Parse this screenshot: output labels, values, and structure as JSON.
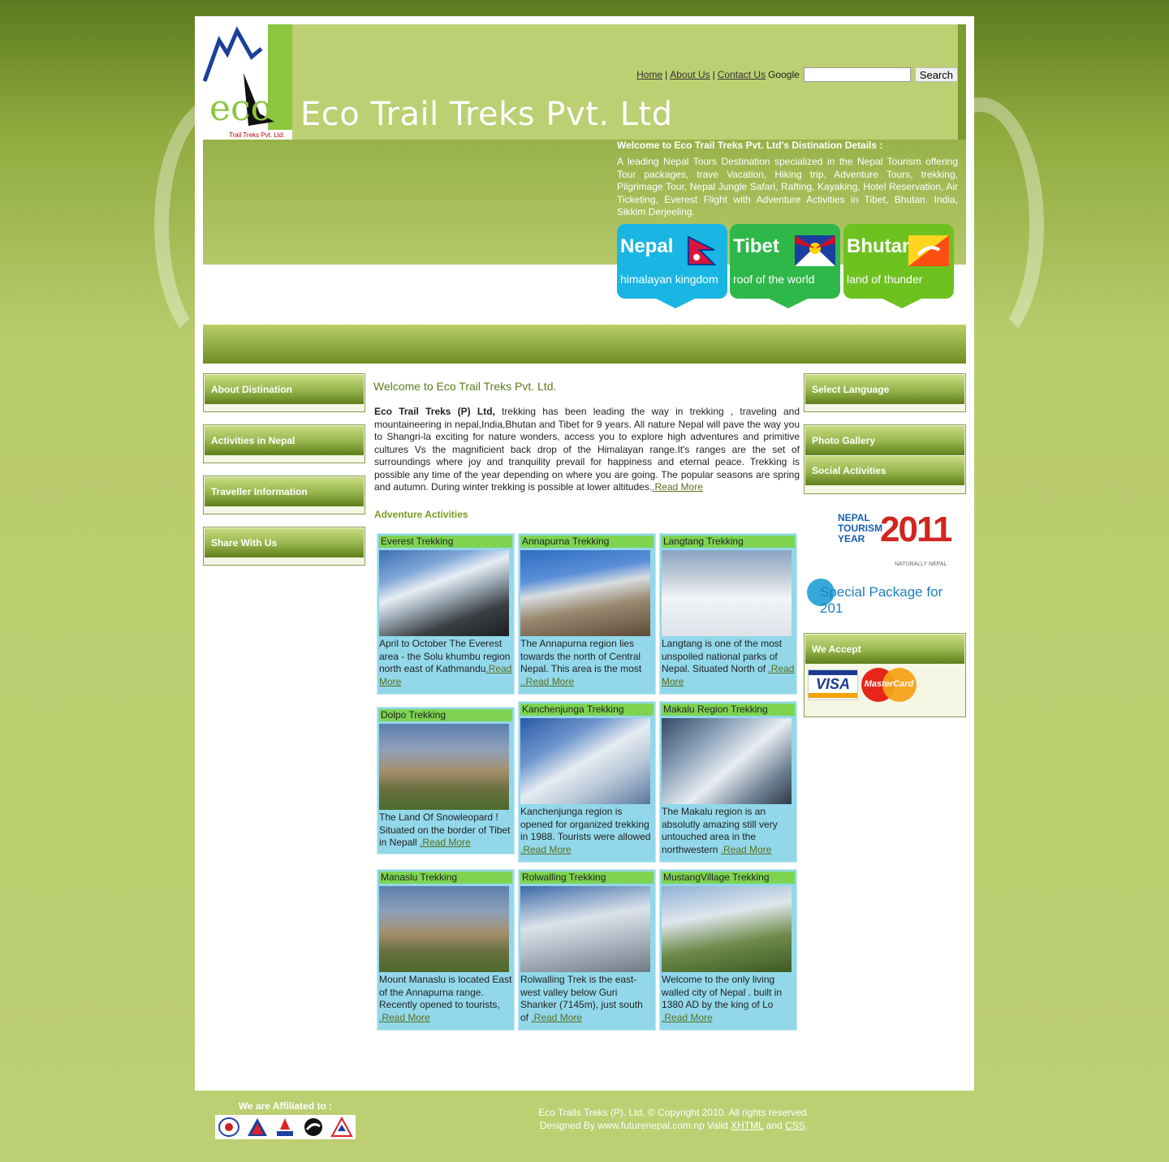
{
  "brand": {
    "name": "Eco Trail Treks Pvt. Ltd",
    "logo_text": "eco",
    "logo_sub": "Trail Treks Pvt. Ltd."
  },
  "topnav": {
    "home": "Home",
    "about": "About Us",
    "contact": "Contact Us",
    "sep": "|",
    "google": "Google",
    "search_value": "",
    "search_button": "Search"
  },
  "welcome": {
    "title": "Welcome to Eco Trail Treks Pvt. Ltd's Distination Details :",
    "text": "A leading Nepal Tours Destination specialized in the Nepal Tourism offering Tour packages, trave Vacation, Hiking trip, Adventure Tours, trekking, Pilgrimage Tour, Nepal Jungle Safari, Rafting, Kayaking, Hotel Reservation, Air Ticketing, Everest Flight with Adventure Activities in Tibet, Bhutan. India, Sikkim Derjeeling."
  },
  "destinations": [
    {
      "name": "Nepal",
      "tagline": "himalayan kingdom",
      "color": "#19b6e3"
    },
    {
      "name": "Tibet",
      "tagline": "roof of the world",
      "color": "#2fb84a"
    },
    {
      "name": "Bhutan",
      "tagline": "land of thunder",
      "color": "#6ec21f"
    }
  ],
  "left_boxes": [
    "About Distination",
    "Activities in Nepal",
    "Traveller Information",
    "Share With Us"
  ],
  "right_boxes": {
    "language": "Select Language",
    "gallery": "Photo Gallery",
    "social": "Social Activities",
    "accept": "We Accept"
  },
  "promo": {
    "line1": "NEPAL",
    "line2": "TOURISM",
    "line3": "YEAR",
    "year": "2011",
    "tag": "NATURALLY NEPAL",
    "special": "Special Package for 201"
  },
  "payment": {
    "visa": "VISA",
    "mastercard": "MasterCard"
  },
  "content": {
    "title": "Welcome to Eco Trail Treks Pvt. Ltd.",
    "company": "Eco Trail Treks (P) Ltd,",
    "intro": " trekking has been leading the way in trekking , traveling and mountaineering in nepal,India,Bhutan and Tibet for 9 years. All nature Nepal will pave the way you to Shangri-la exciting for nature wonders, access you to explore high adventures and primitive cultures Vs the magnificient back drop of the Himalayan range.It's ranges are the set of surroundings where joy and tranquility prevail for happiness and eternal peace. Trekking is possible any time of the year depending on where you are going. The popular seasons are spring and autumn. During winter trekking is possible at lower altitudes.",
    "intro_more": ".Read More",
    "adventure": "Adventure Activities"
  },
  "treks": [
    {
      "title": "Everest Trekking",
      "text": "April to October The Everest area - the Solu khumbu region north east of Kathmandu",
      "more": ".Read More"
    },
    {
      "title": "Annapurna Trekking",
      "text": "The Annapurna region lies towards the north of Central Nepal. This area is the most ",
      "more": "..Read More"
    },
    {
      "title": "Langtang Trekking",
      "text": "Langtang is one of the most unspoiled national parks of Nepal. Situated North of ",
      "more": ".Read More"
    },
    {
      "title": "Dolpo Trekking",
      "text": "The Land Of Snowleopard ! Situated on the border of Tibet in Nepall ",
      "more": ".Read More"
    },
    {
      "title": "Kanchenjunga Trekking",
      "text": "Kanchenjunga region is opened for organized trekking in 1988. Tourists were allowed ",
      "more": ".Read More"
    },
    {
      "title": "Makalu Region Trekking",
      "text": "The Makalu region is an absolutly amazing still very untouched area in the northwestern ",
      "more": ".Read More"
    },
    {
      "title": "Manaslu Trekking",
      "text": "Mount Manaslu is located East of the Annapurna range. Recently opened to tourists, ",
      "more": ".Read More"
    },
    {
      "title": "Rolwalling Trekking",
      "text": "Rolwalling Trek is the east-west valley below Guri Shanker (7145m), just south of ",
      "more": ".Read More"
    },
    {
      "title": "MustangVillage Trekking",
      "text": "Welcome to the only living walled city of Nepal . built in 1380 AD by the king of Lo ",
      "more": ".Read More"
    }
  ],
  "footer": {
    "affiliated": "We are Affiliated to :",
    "copyright": "Eco Trails Treks (P). Ltd, © Copyright 2010. All rights reserved.",
    "designed": "Designed By www.futurenepal.com.np Valid ",
    "xhtml": "XHTML",
    "and": " and ",
    "css": "CSS",
    "dot": "."
  }
}
